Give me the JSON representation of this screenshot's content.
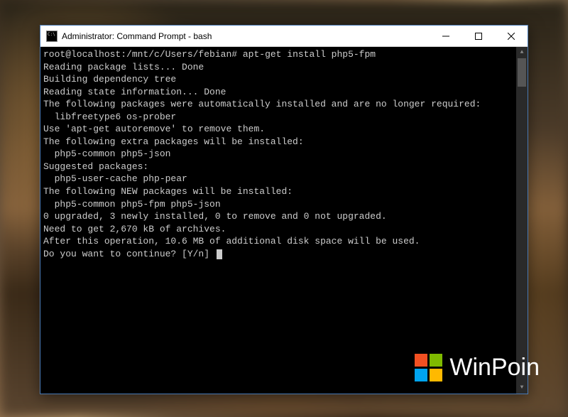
{
  "window": {
    "title": "Administrator: Command Prompt - bash"
  },
  "terminal": {
    "prompt": "root@localhost:/mnt/c/Users/febian#",
    "command": "apt-get install php5-fpm",
    "lines": [
      "Reading package lists... Done",
      "Building dependency tree",
      "Reading state information... Done",
      "The following packages were automatically installed and are no longer required:",
      "  libfreetype6 os-prober",
      "Use 'apt-get autoremove' to remove them.",
      "The following extra packages will be installed:",
      "  php5-common php5-json",
      "Suggested packages:",
      "  php5-user-cache php-pear",
      "The following NEW packages will be installed:",
      "  php5-common php5-fpm php5-json",
      "0 upgraded, 3 newly installed, 0 to remove and 0 not upgraded.",
      "Need to get 2,670 kB of archives.",
      "After this operation, 10.6 MB of additional disk space will be used.",
      "Do you want to continue? [Y/n]"
    ]
  },
  "watermark": {
    "text": "WinPoin"
  }
}
